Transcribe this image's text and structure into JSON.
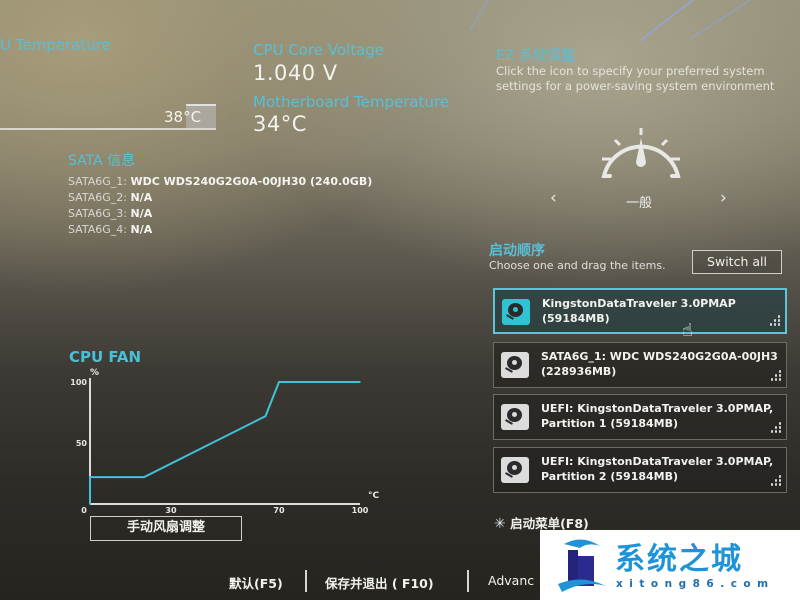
{
  "monitor": {
    "cpu_temp_label": "U Temperature",
    "cpu_temp_value": "38°C",
    "cpu_voltage_label": "CPU Core Voltage",
    "cpu_voltage_value": "1.040 V",
    "mb_temp_label": "Motherboard Temperature",
    "mb_temp_value": "34°C"
  },
  "sata": {
    "title": "SATA 信息",
    "ports": [
      {
        "port": "SATA6G_1:",
        "device": "WDC WDS240G2G0A-00JH30 (240.0GB)"
      },
      {
        "port": "SATA6G_2:",
        "device": "N/A"
      },
      {
        "port": "SATA6G_3:",
        "device": "N/A"
      },
      {
        "port": "SATA6G_4:",
        "device": "N/A"
      }
    ]
  },
  "ez_tuning": {
    "title": "EZ 系统调整",
    "description": "Click the icon to specify your preferred system settings for a power-saving system environment",
    "mode": "一般",
    "prev_glyph": "‹",
    "next_glyph": "›"
  },
  "boot_priority": {
    "title": "启动顺序",
    "hint": "Choose one and drag the items.",
    "switch_all_label": "Switch all",
    "items": [
      {
        "line1": "KingstonDataTraveler 3.0PMAP",
        "line2": "(59184MB)",
        "selected": true
      },
      {
        "line1": "SATA6G_1: WDC WDS240G2G0A-00JH3",
        "line2": "(228936MB)",
        "selected": false
      },
      {
        "line1": "UEFI: KingstonDataTraveler 3.0PMAP,",
        "line2": "Partition 1 (59184MB)",
        "selected": false
      },
      {
        "line1": "UEFI: KingstonDataTraveler 3.0PMAP,",
        "line2": "Partition 2 (59184MB)",
        "selected": false
      }
    ],
    "boot_menu_label": "启动菜单(F8)"
  },
  "cpu_fan": {
    "title": "CPU FAN",
    "manual_button_label": "手动风扇调整"
  },
  "chart_data": {
    "type": "line",
    "title": "CPU FAN",
    "xlabel": "°C",
    "ylabel": "%",
    "xlim": [
      0,
      100
    ],
    "ylim": [
      0,
      100
    ],
    "x_ticks": [
      "0",
      "30",
      "70",
      "100"
    ],
    "x_tick_values": [
      0,
      30,
      70,
      100
    ],
    "y_ticks": [
      "0",
      "50",
      "100"
    ],
    "y_tick_values": [
      0,
      50,
      100
    ],
    "grid": false,
    "series": [
      {
        "name": "CPU FAN",
        "color": "#3fc3d8",
        "x": [
          0,
          0,
          20,
          65,
          70,
          100
        ],
        "y": [
          0,
          22,
          22,
          72,
          100,
          100
        ]
      }
    ]
  },
  "footer": {
    "default_label": "默认(F5)",
    "save_exit_label": "保存并退出 ( F10)",
    "advanced_label": "Advanc"
  },
  "watermark": {
    "title": "系统之城",
    "url": "xitong86.com"
  },
  "colors": {
    "accent": "#56c4d9",
    "selected_border": "#5cc6d9",
    "fan_curve": "#3fc3d8"
  }
}
